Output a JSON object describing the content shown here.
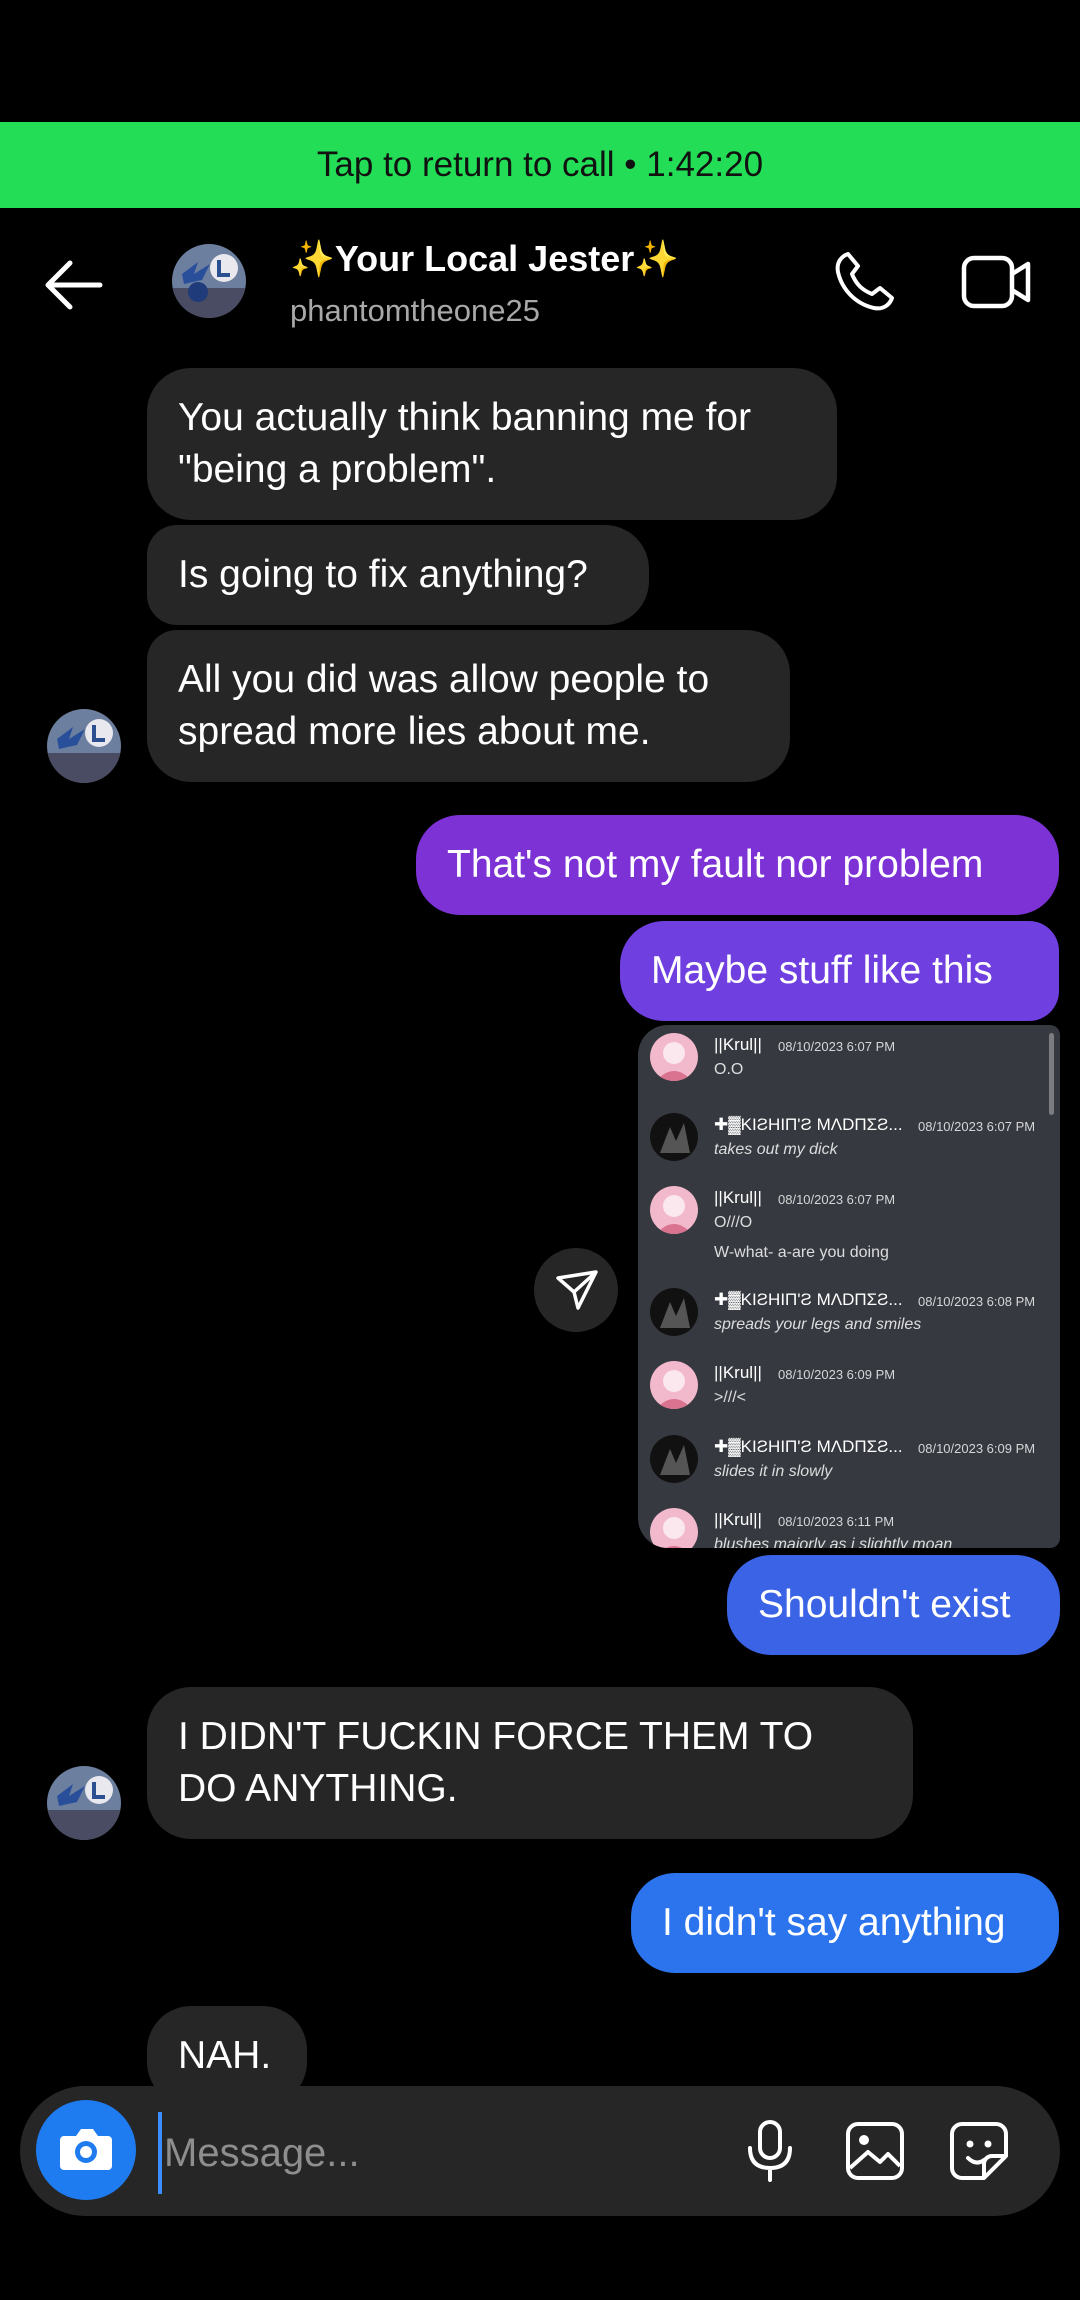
{
  "call_banner": {
    "text": "Tap to return to call • 1:42:20"
  },
  "header": {
    "display_name": "✨Your Local Jester✨",
    "username": "phantomtheone25",
    "back_icon": "arrow-left-icon",
    "call_icon": "phone-icon",
    "video_icon": "video-camera-icon"
  },
  "messages": [
    {
      "from": "them",
      "text": "You actually think banning me for \"being a problem\"."
    },
    {
      "from": "them",
      "text": "Is going to fix anything?"
    },
    {
      "from": "them",
      "text": "All you did was allow people to spread more lies about me."
    },
    {
      "from": "me",
      "text": "That's not my fault nor problem"
    },
    {
      "from": "me",
      "text": "Maybe stuff like this"
    },
    {
      "from": "me",
      "text": "Shouldn't exist"
    },
    {
      "from": "them",
      "text": "I DIDN'T FUCKIN FORCE THEM TO DO ANYTHING."
    },
    {
      "from": "me",
      "text": "I didn't say anything"
    },
    {
      "from": "them",
      "text": "NAH."
    }
  ],
  "shared_image": {
    "share_icon": "send-icon",
    "messages": [
      {
        "user": "||Krul||",
        "time": "08/10/2023 6:07 PM",
        "text": "O.O"
      },
      {
        "user": "✚▓KIƧHIП'Ƨ MΛDПΣƧ...",
        "time": "08/10/2023 6:07 PM",
        "text": "takes out my dick"
      },
      {
        "user": "||Krul||",
        "time": "08/10/2023 6:07 PM",
        "text": "O///O",
        "text2": "W-what- a-are you doing"
      },
      {
        "user": "✚▓KIƧHIП'Ƨ MΛDПΣƧ...",
        "time": "08/10/2023 6:08 PM",
        "text": "spreads your legs and smiles"
      },
      {
        "user": "||Krul||",
        "time": "08/10/2023 6:09 PM",
        "text": ">///<"
      },
      {
        "user": "✚▓KIƧHIП'Ƨ MΛDПΣƧ...",
        "time": "08/10/2023 6:09 PM",
        "text": "slides it in slowly"
      },
      {
        "user": "||Krul||",
        "time": "08/10/2023 6:11 PM",
        "text": "blushes majorly as i slightly moan"
      }
    ]
  },
  "composer": {
    "placeholder": "Message...",
    "camera_icon": "camera-icon",
    "mic_icon": "microphone-icon",
    "gallery_icon": "image-icon",
    "sticker_icon": "sticker-icon"
  },
  "colors": {
    "call_banner": "#22dd55",
    "incoming_bubble": "#262626",
    "outgoing_purple": "#7d32d6",
    "outgoing_blue": "#2b74ee",
    "camera_button": "#1e7cf0"
  }
}
